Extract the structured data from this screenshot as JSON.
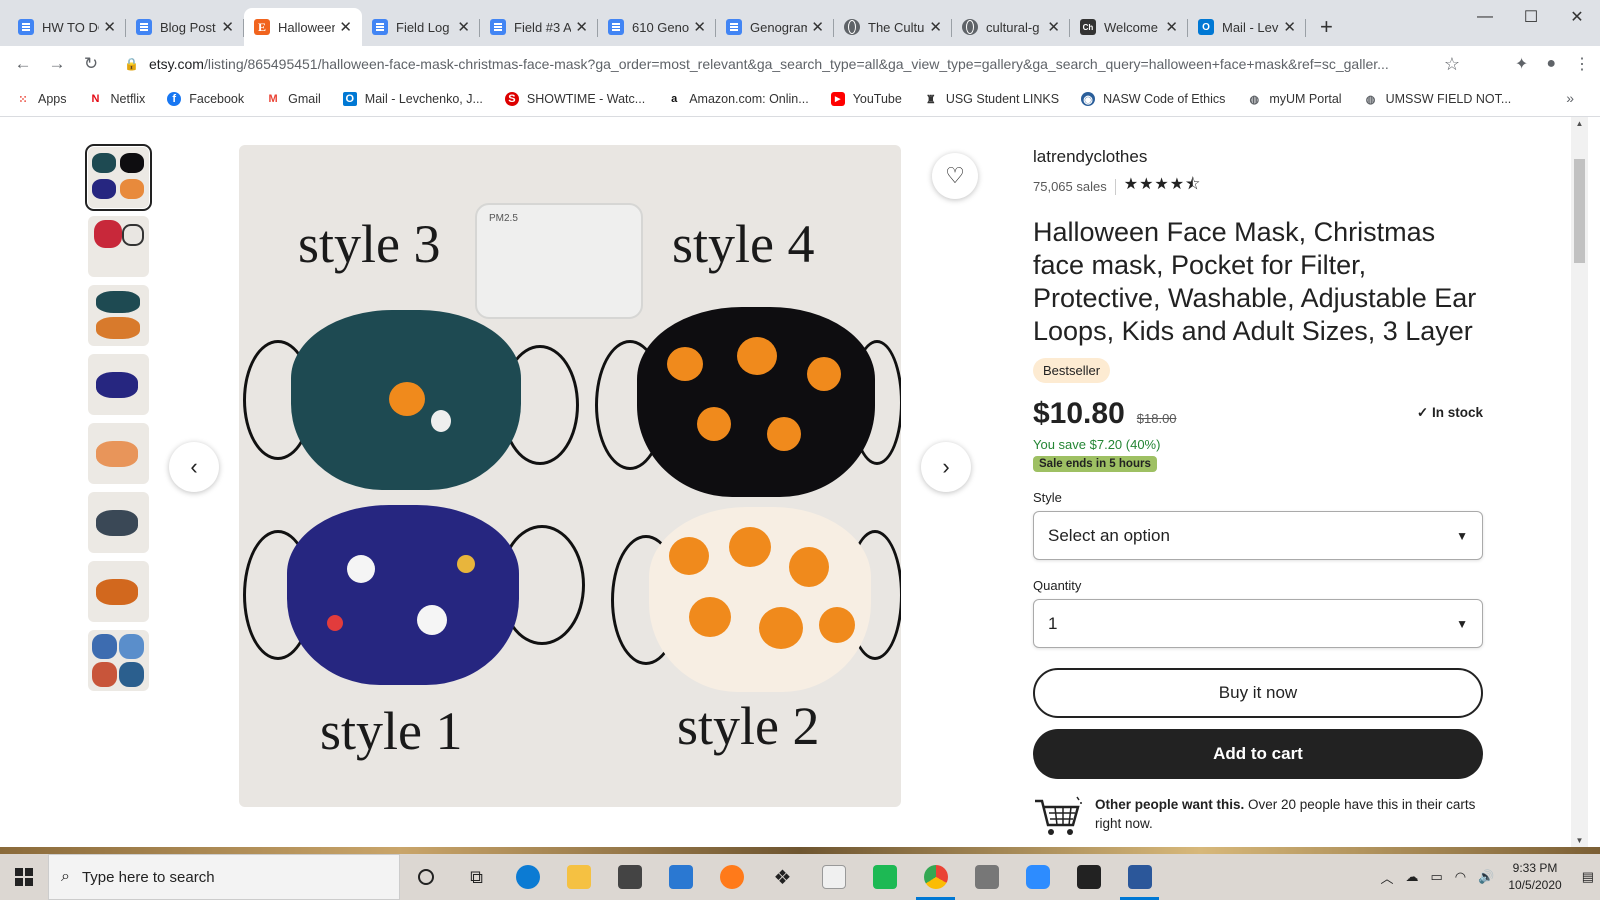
{
  "browser": {
    "tabs": [
      {
        "title": "HW TO DO",
        "icon": "doc-icon"
      },
      {
        "title": "Blog Post",
        "icon": "doc-icon"
      },
      {
        "title": "Halloween",
        "icon": "etsy-icon",
        "active": true
      },
      {
        "title": "Field Log",
        "icon": "doc-icon"
      },
      {
        "title": "Field #3 A",
        "icon": "doc-icon"
      },
      {
        "title": "610 Geno",
        "icon": "doc-icon"
      },
      {
        "title": "Genogram",
        "icon": "doc-icon"
      },
      {
        "title": "The Cultu",
        "icon": "globe-icon"
      },
      {
        "title": "cultural-g",
        "icon": "globe-icon"
      },
      {
        "title": "Welcome",
        "icon": "ch-icon"
      },
      {
        "title": "Mail - Lev",
        "icon": "outlook-icon"
      }
    ],
    "url_host": "etsy.com",
    "url_path": "/listing/865495451/halloween-face-mask-christmas-face-mask?ga_order=most_relevant&ga_search_type=all&ga_view_type=gallery&ga_search_query=halloween+face+mask&ref=sc_galler...",
    "bookmarks": [
      {
        "label": "Apps",
        "icon": "apps-icon",
        "color": "#ea4335"
      },
      {
        "label": "Netflix",
        "icon": "netflix-icon",
        "color": "#e50914"
      },
      {
        "label": "Facebook",
        "icon": "facebook-icon",
        "color": "#1877f2"
      },
      {
        "label": "Gmail",
        "icon": "gmail-icon",
        "color": "#ea4335"
      },
      {
        "label": "Mail - Levchenko, J...",
        "icon": "outlook-icon",
        "color": "#0078d4"
      },
      {
        "label": "SHOWTIME - Watc...",
        "icon": "showtime-icon",
        "color": "#d00"
      },
      {
        "label": "Amazon.com: Onlin...",
        "icon": "amazon-icon",
        "color": "#111"
      },
      {
        "label": "YouTube",
        "icon": "youtube-icon",
        "color": "#ff0000"
      },
      {
        "label": "USG Student LINKS",
        "icon": "usg-icon",
        "color": "#333"
      },
      {
        "label": "NASW Code of Ethics",
        "icon": "nasw-icon",
        "color": "#2a5e9a"
      },
      {
        "label": "myUM Portal",
        "icon": "globe-icon",
        "color": "#5f6368"
      },
      {
        "label": "UMSSW FIELD NOT...",
        "icon": "globe-icon",
        "color": "#5f6368"
      }
    ],
    "bookmarks_more": "»"
  },
  "listing": {
    "image_labels": {
      "s3": "style 3",
      "s4": "style 4",
      "s1": "style 1",
      "s2": "style 2",
      "filter": "PM2.5"
    },
    "shop_name": "latrendyclothes",
    "sales": "75,065 sales",
    "rating_stars": "★★★★⯪",
    "title": "Halloween Face Mask, Christmas face mask, Pocket for Filter, Protective, Washable, Adjustable Ear Loops, Kids and Adult Sizes, 3 Layer",
    "badge": "Bestseller",
    "price": "$10.80",
    "old_price": "$18.00",
    "stock": "In stock",
    "savings": "You save $7.20 (40%)",
    "sale_ends": "Sale ends in 5 hours",
    "style_label": "Style",
    "style_value": "Select an option",
    "quantity_label": "Quantity",
    "quantity_value": "1",
    "buy_now": "Buy it now",
    "add_to_cart": "Add to cart",
    "others_bold": "Other people want this.",
    "others_text": " Over 20 people have this in their carts right now."
  },
  "taskbar": {
    "search_placeholder": "Type here to search",
    "time": "9:33 PM",
    "date": "10/5/2020"
  },
  "colors": {
    "etsy_orange": "#f1641e",
    "sale_green": "#9ec063",
    "savings_green": "#258635",
    "bestseller_bg": "#fdebd2"
  }
}
